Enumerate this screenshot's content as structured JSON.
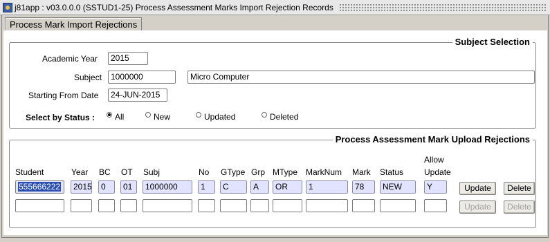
{
  "window": {
    "title": "j81app : v03.0.0.0  (SSTUD1-25) Process Assessment Marks Import Rejection Records"
  },
  "tab": {
    "label": "Process Mark Import Rejections"
  },
  "subject_selection": {
    "title": "Subject Selection",
    "academic_year_label": "Academic Year",
    "academic_year": "2015",
    "subject_label": "Subject",
    "subject_code": "1000000",
    "subject_name": "Micro Computer",
    "start_date_label": "Starting From Date",
    "start_date": "24-JUN-2015",
    "status_label": "Select by Status :",
    "status_options": [
      "All",
      "New",
      "Updated",
      "Deleted"
    ],
    "status_selected": "All"
  },
  "rejections": {
    "title": "Process Assessment Mark Upload Rejections",
    "headers": {
      "student": "Student",
      "year": "Year",
      "bc": "BC",
      "ot": "OT",
      "subj": "Subj",
      "no": "No",
      "gtype": "GType",
      "grp": "Grp",
      "mtype": "MType",
      "marknum": "MarkNum",
      "mark": "Mark",
      "status": "Status",
      "allow_update_1": "Allow",
      "allow_update_2": "Update"
    },
    "rows": [
      {
        "student": "555666222",
        "year": "2015",
        "bc": "0",
        "ot": "01",
        "subj": "1000000",
        "no": "1",
        "gtype": "C",
        "grp": "A",
        "mtype": "OR",
        "marknum": "1",
        "mark": "78",
        "status": "NEW",
        "allow_update": "Y",
        "update_label": "Update",
        "delete_label": "Delete"
      },
      {
        "student": "",
        "year": "",
        "bc": "",
        "ot": "",
        "subj": "",
        "no": "",
        "gtype": "",
        "grp": "",
        "mtype": "",
        "marknum": "",
        "mark": "",
        "status": "",
        "allow_update": "",
        "update_label": "Update",
        "delete_label": "Delete"
      }
    ]
  }
}
